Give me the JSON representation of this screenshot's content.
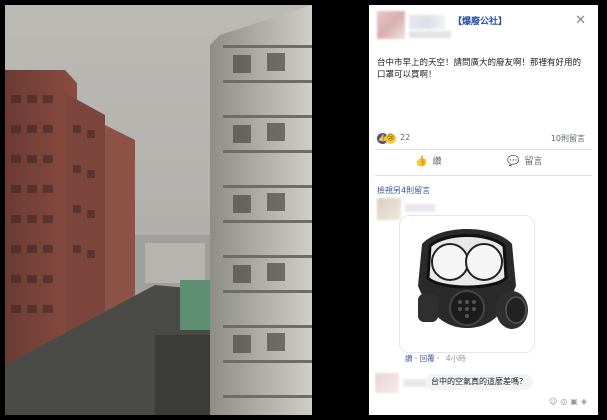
{
  "post": {
    "page_name": "【爆廢公社】",
    "text": "台中市早上的天空！請問廣大的廢友啊！那裡有好用的口罩可以買啊！",
    "reactions_count": "22",
    "shares_label": "10則留言",
    "comments_count_small": "",
    "like_label": "讚",
    "comment_label": "留言"
  },
  "comment": {
    "author_label": "檢視另4則留言",
    "like_label": "讚",
    "reply_label": "回覆",
    "time_label": "4小時"
  },
  "reply": {
    "text": "台中的空氣真的這麼差嗎？"
  },
  "colors": {
    "accent": "#3b5998",
    "link": "#385898",
    "background": "#000000"
  },
  "icons": [
    "like-icon",
    "sad-icon",
    "thumb-up-icon",
    "comment-icon",
    "close-icon",
    "gas-mask-image",
    "camera-icon",
    "emoji-icon",
    "gif-icon",
    "sticker-icon"
  ]
}
